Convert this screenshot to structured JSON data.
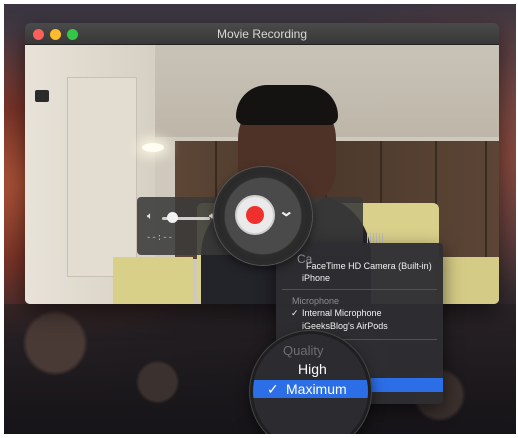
{
  "window": {
    "title": "Movie Recording"
  },
  "controls": {
    "volume_low_icon": "speaker-low-icon",
    "volume_high_icon": "speaker-high-icon",
    "volume_level": 0.2,
    "elapsed_time": "--:--",
    "record_button_color": "#f0302c"
  },
  "menu": {
    "camera_items": [
      "FaceTime HD Camera (Built-in)",
      "iPhone"
    ],
    "microphone_header": "Microphone",
    "microphone_items": [
      {
        "label": "Internal Microphone",
        "checked": true
      },
      {
        "label": "iGeeksBlog's AirPods",
        "checked": false
      }
    ],
    "quality_header": "Quality",
    "quality_items": [
      {
        "label": "High",
        "checked": false
      },
      {
        "label": "Maximum",
        "checked": true
      }
    ],
    "selection_color": "#2b6ee6"
  },
  "magnifier": {
    "camera_header_fragment": "Ca",
    "quality_header": "Quality",
    "high": "High",
    "maximum": "Maximum",
    "check_mark": "✓"
  }
}
